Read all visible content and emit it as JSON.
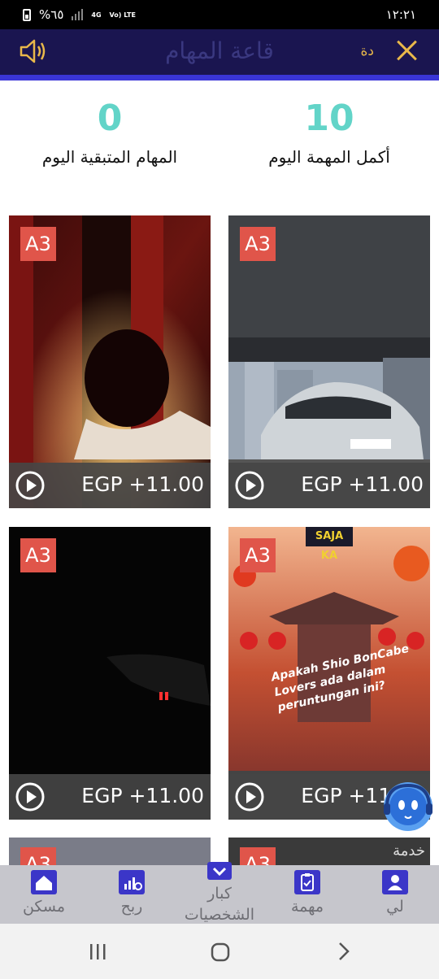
{
  "status_bar": {
    "battery": "%٦٥",
    "network": "4G",
    "volte": "Vo) LTE",
    "time": "١٢:٢١"
  },
  "header": {
    "title": "قاعة المهام",
    "side_label": "دة",
    "colors": {
      "bg": "#1a1550",
      "accent": "#3a35d6",
      "icon": "#e8b84a"
    }
  },
  "stats": {
    "completed": {
      "value": "10",
      "label": "أكمل المهمة اليوم"
    },
    "remaining": {
      "value": "0",
      "label": "المهام المتبقية اليوم"
    }
  },
  "cards": [
    {
      "badge": "A3",
      "price": "EGP +11.00",
      "scene": "woman-by-curtain"
    },
    {
      "badge": "A3",
      "price": "EGP +11.00",
      "scene": "mercedes-under-bridge"
    },
    {
      "badge": "A3",
      "price": "EGP +11.00",
      "scene": "dark-car-light"
    },
    {
      "badge": "A3",
      "price": "EGP +11.00",
      "scene": "chinese-lanterns",
      "overlay_text": "Apakah Shio BonCabe Lovers ada dalam peruntungan ini?",
      "logo_text": "SAJA KA"
    }
  ],
  "partial_row": {
    "badge": "A3",
    "label": "خدمة"
  },
  "bottom_nav": [
    {
      "label": "مسكن",
      "icon": "home-icon"
    },
    {
      "label": "ربح",
      "icon": "chart-icon"
    },
    {
      "label": "كبار الشخصيات",
      "icon": "vip-icon"
    },
    {
      "label": "مهمة",
      "icon": "clipboard-icon"
    },
    {
      "label": "لي",
      "icon": "user-icon"
    }
  ],
  "system_nav": [
    "recents-icon",
    "home-circle-icon",
    "back-chevron-icon"
  ]
}
